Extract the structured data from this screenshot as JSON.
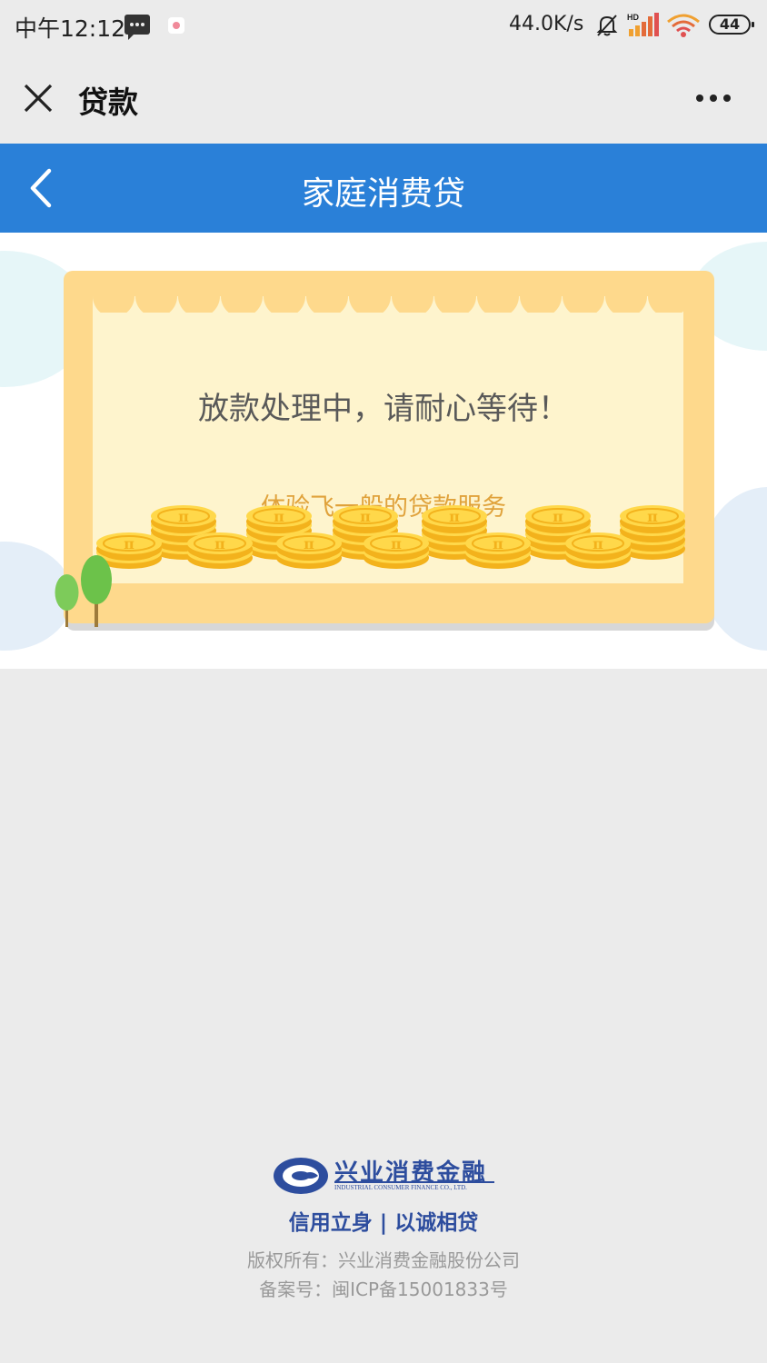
{
  "status_bar": {
    "time": "中午12:12",
    "network_speed": "44.0K/s",
    "network_type": "HD",
    "battery": "44",
    "icons": [
      "message-icon",
      "app-notification-icon",
      "bell-muted-icon",
      "signal-icon",
      "wifi-icon",
      "battery-icon"
    ]
  },
  "title_bar": {
    "title": "贷款",
    "close_icon": "close-icon",
    "more_icon": "more-dots-icon"
  },
  "header": {
    "title": "家庭消费贷",
    "back_icon": "chevron-left-icon",
    "background": "#2a80d8"
  },
  "banner": {
    "message": "放款处理中，请耐心等待！",
    "subtitle": "体验飞一般的贷款服务",
    "coin_symbol": "π"
  },
  "footer": {
    "company_logo_cn": "兴业消费金融",
    "company_logo_en": "INDUSTRIAL CONSUMER FINANCE CO., LTD.",
    "slogan": "信用立身 | 以诚相贷",
    "copyright": "版权所有：兴业消费金融股份公司",
    "icp": "备案号：闽ICP备15001833号",
    "brand_color": "#2d4d9e"
  }
}
